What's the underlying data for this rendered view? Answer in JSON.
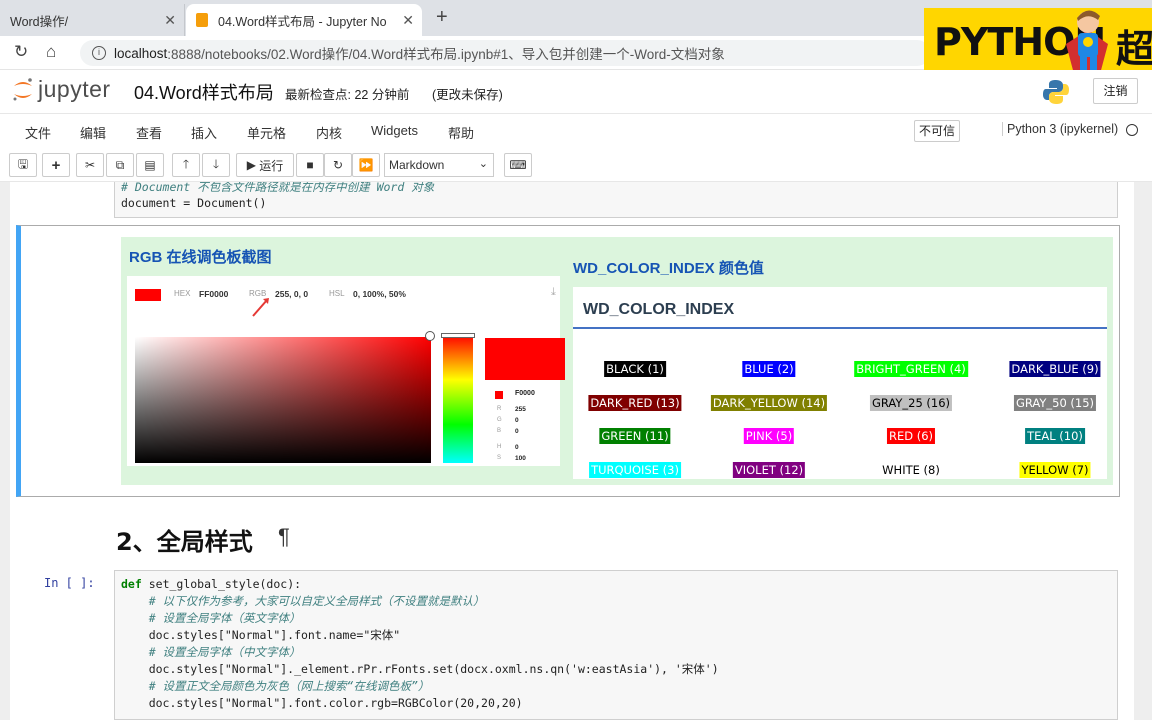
{
  "browser": {
    "tabs": [
      {
        "title": "Word操作/"
      },
      {
        "title": "04.Word样式布局 - Jupyter No"
      }
    ],
    "url_host": "localhost",
    "url_rest": ":8888/notebooks/02.Word操作/04.Word样式布局.ipynb#1、导入包并创建一个-Word-文档对象"
  },
  "banner": {
    "text": "PYTHON",
    "suffix": "超"
  },
  "jupyter": {
    "logo_text": "jupyter",
    "notebook_title": "04.Word样式布局",
    "checkpoint": "最新检查点: 22 分钟前",
    "unsaved": "(更改未保存)",
    "logout": "注销",
    "menu": [
      "文件",
      "编辑",
      "查看",
      "插入",
      "单元格",
      "内核",
      "Widgets",
      "帮助"
    ],
    "trusted": "不可信",
    "kernel": "Python 3 (ipykernel)",
    "run_label": "运行",
    "cell_type": "Markdown"
  },
  "cell1": {
    "line1": "# Document 不包含文件路径就是在内存中创建 Word 对象",
    "line2": "document = Document()"
  },
  "markdown": {
    "rgb_title": "RGB 在线调色板截图",
    "picker": {
      "hex_label": "HEX",
      "hex_value": "FF0000",
      "rgb_label": "RGB",
      "rgb_value": "255, 0, 0",
      "hsl_label": "HSL",
      "hsl_value": "0, 100%, 50%",
      "side_hex": "F0000",
      "side_labels": [
        "R",
        "G",
        "B",
        "H",
        "S"
      ],
      "side_values": [
        "255",
        "0",
        "0",
        "0",
        "100"
      ]
    },
    "wd_title": "WD_COLOR_INDEX 颜色值",
    "wd_header": "WD_COLOR_INDEX",
    "colors": [
      {
        "label": "BLACK (1)",
        "bg": "#000000",
        "fg": "#ffffff"
      },
      {
        "label": "BLUE (2)",
        "bg": "#0000ff",
        "fg": "#ffffff"
      },
      {
        "label": "BRIGHT_GREEN (4)",
        "bg": "#00ff00",
        "fg": "#ffffff"
      },
      {
        "label": "DARK_BLUE (9)",
        "bg": "#000080",
        "fg": "#ffffff"
      },
      {
        "label": "DARK_RED (13)",
        "bg": "#800000",
        "fg": "#ffffff"
      },
      {
        "label": "DARK_YELLOW (14)",
        "bg": "#808000",
        "fg": "#ffffff"
      },
      {
        "label": "GRAY_25 (16)",
        "bg": "#c0c0c0",
        "fg": "#000000"
      },
      {
        "label": "GRAY_50 (15)",
        "bg": "#808080",
        "fg": "#ffffff"
      },
      {
        "label": "GREEN (11)",
        "bg": "#008000",
        "fg": "#ffffff"
      },
      {
        "label": "PINK (5)",
        "bg": "#ff00ff",
        "fg": "#ffffff"
      },
      {
        "label": "RED (6)",
        "bg": "#ff0000",
        "fg": "#ffffff"
      },
      {
        "label": "TEAL (10)",
        "bg": "#008080",
        "fg": "#ffffff"
      },
      {
        "label": "TURQUOISE (3)",
        "bg": "#00ffff",
        "fg": "#ffffff"
      },
      {
        "label": "VIOLET (12)",
        "bg": "#800080",
        "fg": "#ffffff"
      },
      {
        "label": "WHITE (8)",
        "bg": "#ffffff",
        "fg": "#000000"
      },
      {
        "label": "YELLOW (7)",
        "bg": "#ffff00",
        "fg": "#000000"
      }
    ]
  },
  "heading": "2、全局样式",
  "cell2": {
    "prompt": "In [ ]:",
    "lines": [
      "def set_global_style(doc):",
      "    # 以下仅作为参考，大家可以自定义全局样式（不设置就是默认）",
      "    # 设置全局字体（英文字体）",
      "    doc.styles[\"Normal\"].font.name=\"宋体\"",
      "    # 设置全局字体（中文字体）",
      "    doc.styles[\"Normal\"]._element.rPr.rFonts.set(docx.oxml.ns.qn('w:eastAsia'), '宋体')",
      "    # 设置正文全局颜色为灰色（网上搜索“在线调色板”）",
      "    doc.styles[\"Normal\"].font.color.rgb=RGBColor(20,20,20)"
    ]
  }
}
